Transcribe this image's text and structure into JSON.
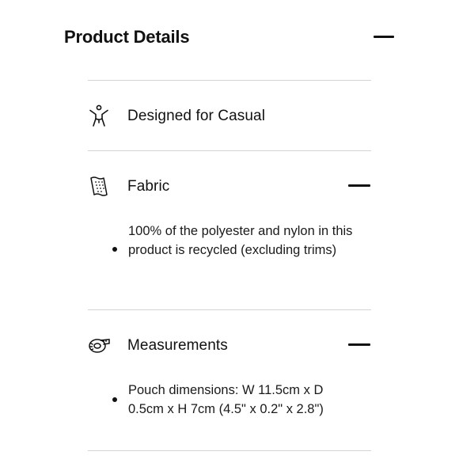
{
  "panel": {
    "title": "Product Details"
  },
  "rows": [
    {
      "label": "Designed for Casual",
      "icon": "person-stretch-icon"
    },
    {
      "label": "Fabric",
      "icon": "fabric-swatch-icon",
      "detail": "100% of the polyester and nylon in this product is recycled (excluding trims)"
    },
    {
      "label": "Measurements",
      "icon": "measuring-tape-icon",
      "detail": "Pouch dimensions: W 11.5cm x D 0.5cm x H 7cm (4.5\" x 0.2\" x 2.8\")"
    }
  ],
  "colors": {
    "text": "#111111",
    "divider": "#d4d4d4",
    "background": "#ffffff"
  }
}
